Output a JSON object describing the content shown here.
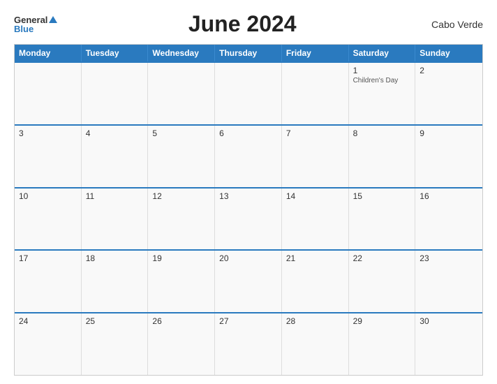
{
  "header": {
    "logo_general": "General",
    "logo_blue": "Blue",
    "title": "June 2024",
    "country": "Cabo Verde"
  },
  "calendar": {
    "days_of_week": [
      "Monday",
      "Tuesday",
      "Wednesday",
      "Thursday",
      "Friday",
      "Saturday",
      "Sunday"
    ],
    "weeks": [
      [
        {
          "num": "",
          "event": ""
        },
        {
          "num": "",
          "event": ""
        },
        {
          "num": "",
          "event": ""
        },
        {
          "num": "",
          "event": ""
        },
        {
          "num": "",
          "event": ""
        },
        {
          "num": "1",
          "event": "Children's Day"
        },
        {
          "num": "2",
          "event": ""
        }
      ],
      [
        {
          "num": "3",
          "event": ""
        },
        {
          "num": "4",
          "event": ""
        },
        {
          "num": "5",
          "event": ""
        },
        {
          "num": "6",
          "event": ""
        },
        {
          "num": "7",
          "event": ""
        },
        {
          "num": "8",
          "event": ""
        },
        {
          "num": "9",
          "event": ""
        }
      ],
      [
        {
          "num": "10",
          "event": ""
        },
        {
          "num": "11",
          "event": ""
        },
        {
          "num": "12",
          "event": ""
        },
        {
          "num": "13",
          "event": ""
        },
        {
          "num": "14",
          "event": ""
        },
        {
          "num": "15",
          "event": ""
        },
        {
          "num": "16",
          "event": ""
        }
      ],
      [
        {
          "num": "17",
          "event": ""
        },
        {
          "num": "18",
          "event": ""
        },
        {
          "num": "19",
          "event": ""
        },
        {
          "num": "20",
          "event": ""
        },
        {
          "num": "21",
          "event": ""
        },
        {
          "num": "22",
          "event": ""
        },
        {
          "num": "23",
          "event": ""
        }
      ],
      [
        {
          "num": "24",
          "event": ""
        },
        {
          "num": "25",
          "event": ""
        },
        {
          "num": "26",
          "event": ""
        },
        {
          "num": "27",
          "event": ""
        },
        {
          "num": "28",
          "event": ""
        },
        {
          "num": "29",
          "event": ""
        },
        {
          "num": "30",
          "event": ""
        }
      ]
    ]
  }
}
